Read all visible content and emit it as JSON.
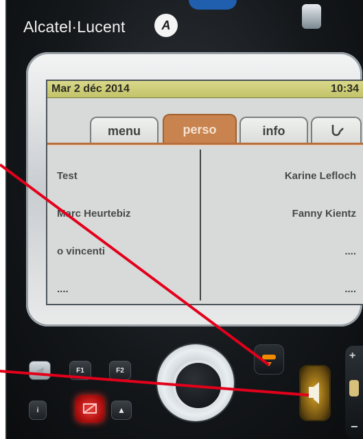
{
  "brand": {
    "name": "Alcatel·Lucent",
    "logo_glyph": "A"
  },
  "screen": {
    "date": "Mar 2 déc 2014",
    "time": "10:34",
    "tabs": [
      {
        "label": "menu",
        "active": false
      },
      {
        "label": "perso",
        "active": true
      },
      {
        "label": "info",
        "active": false
      }
    ],
    "contacts_left": [
      "Test",
      "Marc Heurtebiz",
      "o vincenti",
      "...."
    ],
    "contacts_right": [
      "Karine Lefloch",
      "Fanny Kientz",
      "....",
      "...."
    ]
  },
  "keys": {
    "f1": "F1",
    "f2": "F2",
    "info": "i"
  },
  "colors": {
    "status_bar": "#c2c36a",
    "active_tab": "#c9834e",
    "annotation": "#e3001b",
    "hangup_accent": "#f08a00"
  }
}
